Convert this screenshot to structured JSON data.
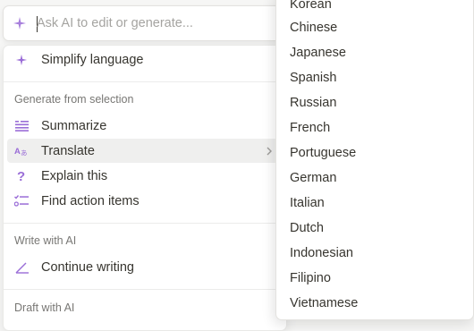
{
  "ask_bar": {
    "placeholder": "Ask AI to edit or generate...",
    "icon": "sparkle-icon"
  },
  "menu": {
    "top_item": {
      "label": "Simplify language",
      "icon": "sparkle-icon"
    },
    "sections": [
      {
        "title": "Generate from selection",
        "items": [
          {
            "label": "Summarize",
            "icon": "summary-lines-icon"
          },
          {
            "label": "Translate",
            "icon": "translate-icon",
            "has_submenu": true
          },
          {
            "label": "Explain this",
            "icon": "question-mark-icon"
          },
          {
            "label": "Find action items",
            "icon": "checklist-icon"
          }
        ]
      },
      {
        "title": "Write with AI",
        "items": [
          {
            "label": "Continue writing",
            "icon": "pen-line-icon"
          }
        ]
      },
      {
        "title": "Draft with AI",
        "items": []
      }
    ]
  },
  "submenu": {
    "languages": [
      "Korean",
      "Chinese",
      "Japanese",
      "Spanish",
      "Russian",
      "French",
      "Portuguese",
      "German",
      "Italian",
      "Dutch",
      "Indonesian",
      "Filipino",
      "Vietnamese"
    ]
  },
  "colors": {
    "accent": "#9a6dd7",
    "hover": "#efefee",
    "text": "#37352f",
    "muted": "#787774"
  }
}
